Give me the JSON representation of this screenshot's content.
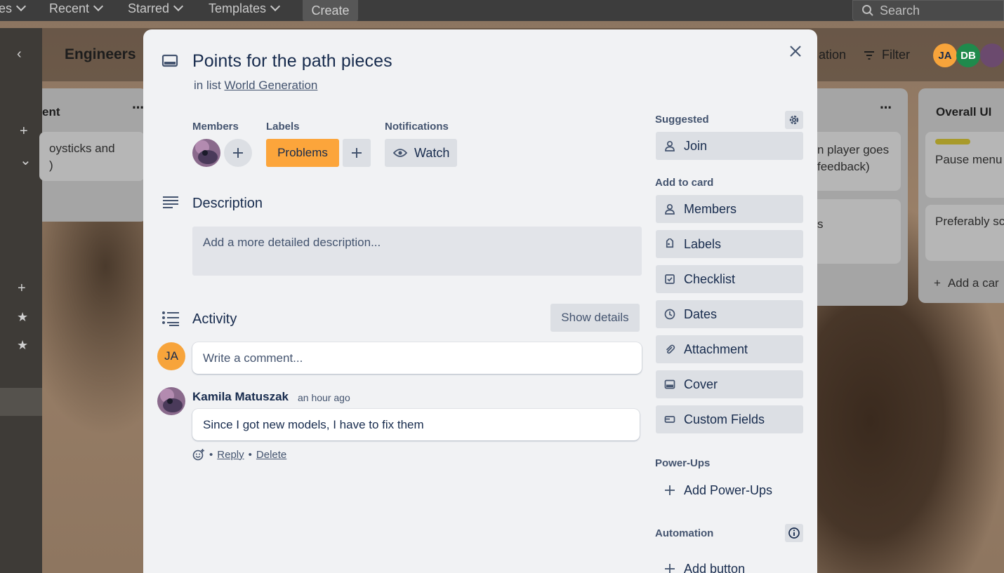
{
  "topbar": {
    "items": [
      {
        "label": "es"
      },
      {
        "label": "Recent"
      },
      {
        "label": "Starred"
      },
      {
        "label": "Templates"
      }
    ],
    "create_label": "Create",
    "search_placeholder": "Search"
  },
  "board": {
    "title": "Engineers",
    "automation_partial": "ation",
    "filter_label": "Filter",
    "members": [
      {
        "initials": "JA",
        "color": "#f7a43b"
      },
      {
        "initials": "DB",
        "color": "#1f8a4c"
      }
    ],
    "lists": [
      {
        "title": "ent",
        "cards": [
          {
            "text": "oysticks and\n)"
          }
        ]
      },
      {
        "title": "",
        "cards": [
          {
            "text": "n player goes\nfeedback)"
          },
          {
            "text": "s"
          }
        ]
      },
      {
        "title": "Overall UI",
        "cards": [
          {
            "text": "Pause menu"
          },
          {
            "text": "Preferably sc"
          }
        ],
        "add_card": "Add a car"
      }
    ]
  },
  "card": {
    "title": "Points for the path pieces",
    "in_list_prefix": "in list",
    "list_name": "World Generation",
    "members_label": "Members",
    "labels_label": "Labels",
    "label_chip": {
      "text": "Problems",
      "color": "#fca53b"
    },
    "notifications_label": "Notifications",
    "watch_label": "Watch",
    "description_heading": "Description",
    "description_placeholder": "Add a more detailed description...",
    "activity_heading": "Activity",
    "show_details_label": "Show details",
    "current_user_initials": "JA",
    "comment_placeholder": "Write a comment...",
    "comment": {
      "author": "Kamila Matuszak",
      "time": "an hour ago",
      "text": "Since I got new models, I have to fix them",
      "reply_label": "Reply",
      "delete_label": "Delete",
      "separator": "•"
    }
  },
  "sidebar": {
    "suggested_title": "Suggested",
    "join_label": "Join",
    "add_to_card_title": "Add to card",
    "add_to_card": [
      {
        "label": "Members",
        "icon": "person-icon"
      },
      {
        "label": "Labels",
        "icon": "tag-icon"
      },
      {
        "label": "Checklist",
        "icon": "checklist-icon"
      },
      {
        "label": "Dates",
        "icon": "clock-icon"
      },
      {
        "label": "Attachment",
        "icon": "paperclip-icon"
      },
      {
        "label": "Cover",
        "icon": "cover-icon"
      },
      {
        "label": "Custom Fields",
        "icon": "custom-fields-icon"
      }
    ],
    "powerups_title": "Power-Ups",
    "add_powerups_label": "Add Power-Ups",
    "automation_title": "Automation",
    "add_button_label": "Add button"
  }
}
